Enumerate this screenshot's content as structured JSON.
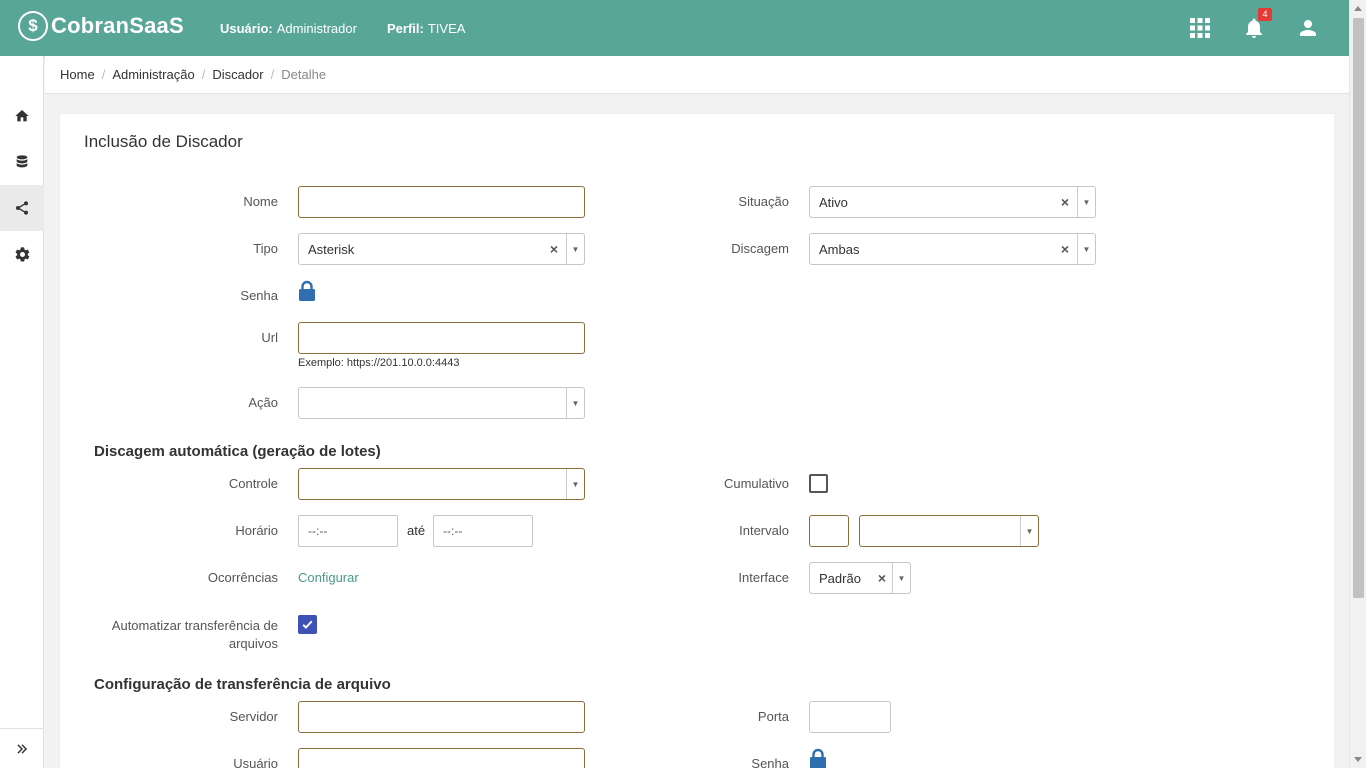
{
  "app": {
    "name": "CobranSaaS",
    "logo_glyph": "$"
  },
  "header": {
    "user_label": "Usuário:",
    "user_value": "Administrador",
    "profile_label": "Perfil:",
    "profile_value": "TIVEA",
    "notifications_count": "4"
  },
  "breadcrumb": [
    "Home",
    "Administração",
    "Discador",
    "Detalhe"
  ],
  "form": {
    "title": "Inclusão de Discador",
    "nome_label": "Nome",
    "situacao_label": "Situação",
    "situacao_value": "Ativo",
    "tipo_label": "Tipo",
    "tipo_value": "Asterisk",
    "discagem_label": "Discagem",
    "discagem_value": "Ambas",
    "senha_label": "Senha",
    "url_label": "Url",
    "url_hint": "Exemplo: https://201.10.0.0:4443",
    "acao_label": "Ação"
  },
  "auto": {
    "title": "Discagem automática (geração de lotes)",
    "controle_label": "Controle",
    "cumulativo_label": "Cumulativo",
    "cumulativo_checked": false,
    "horario_label": "Horário",
    "horario_from": "--:--",
    "ate_label": "até",
    "horario_to": "--:--",
    "intervalo_label": "Intervalo",
    "ocorrencias_label": "Ocorrências",
    "configurar_link": "Configurar",
    "interface_label": "Interface",
    "interface_value": "Padrão",
    "automatizar_label_1": "Automatizar transferência de",
    "automatizar_label_2": "arquivos",
    "automatizar_checked": true
  },
  "transfer": {
    "title": "Configuração de transferência de arquivo",
    "servidor_label": "Servidor",
    "porta_label": "Porta",
    "usuario_label": "Usuário",
    "senha_label": "Senha"
  },
  "colors": {
    "header": "#58a697",
    "accent_link": "#48998a",
    "lock": "#2f6fb0",
    "checkbox": "#3f51b5",
    "badge": "#e53935"
  }
}
